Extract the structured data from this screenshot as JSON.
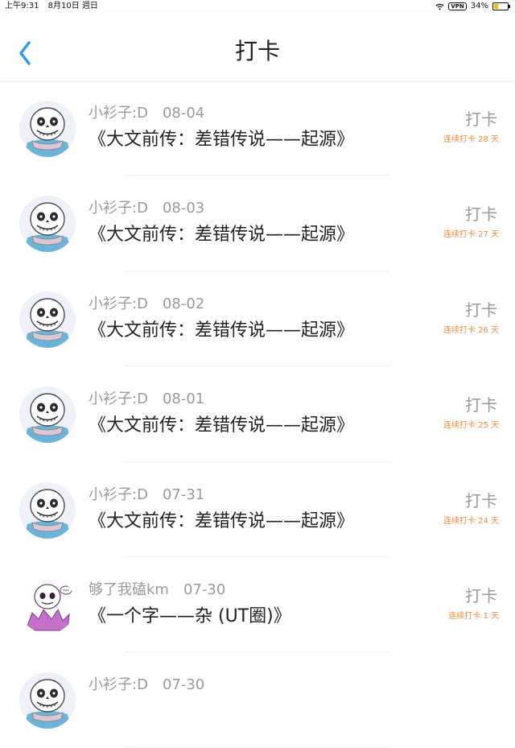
{
  "status_bar": {
    "time": "上午9:31",
    "date": "8月10日 週日",
    "vpn": "VPN",
    "battery": "34%",
    "battery_level": 0.34
  },
  "header": {
    "title": "打卡",
    "back_icon": "chevron-left-icon"
  },
  "colors": {
    "accent": "#2a9bf0",
    "streak": "#f08a3c",
    "muted": "#9a9a9a"
  },
  "posts": [
    {
      "user": "小衫子:D",
      "date": "08-04",
      "title": "《大文前传：差错传说——起源》",
      "action": "打卡",
      "streak": "连续打卡 28 天",
      "avatar": "skeleton-avatar"
    },
    {
      "user": "小衫子:D",
      "date": "08-03",
      "title": "《大文前传：差错传说——起源》",
      "action": "打卡",
      "streak": "连续打卡 27 天",
      "avatar": "skeleton-avatar"
    },
    {
      "user": "小衫子:D",
      "date": "08-02",
      "title": "《大文前传：差错传说——起源》",
      "action": "打卡",
      "streak": "连续打卡 26 天",
      "avatar": "skeleton-avatar"
    },
    {
      "user": "小衫子:D",
      "date": "08-01",
      "title": "《大文前传：差错传说——起源》",
      "action": "打卡",
      "streak": "连续打卡 25 天",
      "avatar": "skeleton-avatar"
    },
    {
      "user": "小衫子:D",
      "date": "07-31",
      "title": "《大文前传：差错传说——起源》",
      "action": "打卡",
      "streak": "连续打卡 24 天",
      "avatar": "skeleton-avatar"
    },
    {
      "user": "够了我磕km",
      "date": "07-30",
      "title": "《一个字——杂 (UT圈)》",
      "action": "打卡",
      "streak": "连续打卡 1 天",
      "avatar": "pink-character-avatar"
    },
    {
      "user": "小衫子:D",
      "date": "07-30",
      "title": "",
      "action": "",
      "streak": "",
      "avatar": "skeleton-avatar"
    }
  ]
}
